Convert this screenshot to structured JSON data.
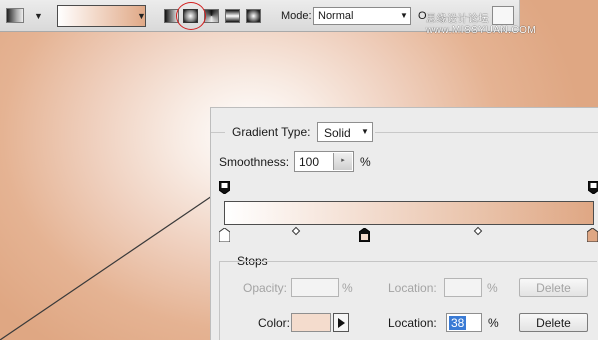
{
  "toolbar": {
    "mode_label": "Mode:",
    "mode_value": "Normal",
    "opacity_label": "O",
    "watermark": "思缘设计论坛 www.MISSYUAN.COM"
  },
  "gradient_editor": {
    "gradient_type_label": "Gradient Type:",
    "gradient_type_value": "Solid",
    "smoothness_label": "Smoothness:",
    "smoothness_value": "100",
    "smoothness_unit": "%",
    "gradient_colors": [
      "#ffffff",
      "#f3ddd0",
      "#e9c2a9",
      "#dfa784"
    ],
    "selected_stop_color": "#f4dccd",
    "stops": {
      "legend": "Stops",
      "opacity_label": "Opacity:",
      "opacity_unit": "%",
      "opacity_location_label": "Location:",
      "opacity_location_unit": "%",
      "opacity_delete_label": "Delete",
      "color_label": "Color:",
      "color_location_label": "Location:",
      "color_location_value": "38",
      "color_location_unit": "%",
      "color_delete_label": "Delete"
    }
  }
}
